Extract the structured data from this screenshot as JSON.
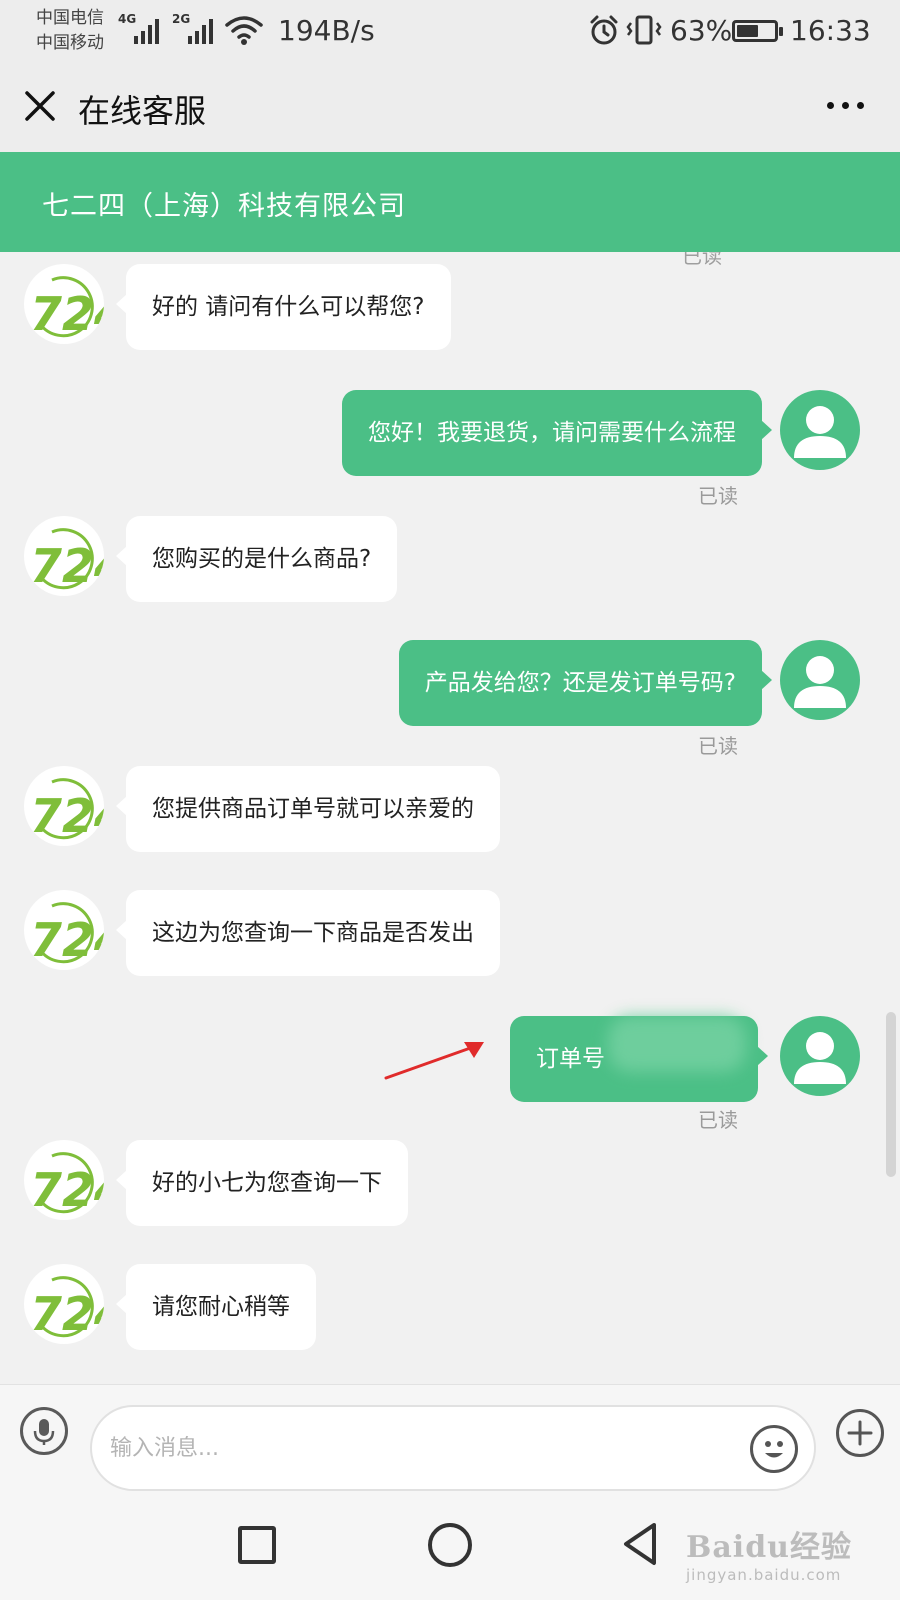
{
  "status_bar": {
    "carrier_1": "中国电信",
    "carrier_2": "中国移动",
    "network_1": "4G",
    "network_2": "2G",
    "net_speed": "194B/s",
    "battery_percent": "63%",
    "battery_level": 0.63,
    "time": "16:33",
    "icons": [
      "alarm-icon",
      "vibrate-icon",
      "wifi-icon",
      "signal-icon"
    ]
  },
  "title_bar": {
    "title": "在线客服",
    "close_icon": "close-icon",
    "more_icon": "more-icon"
  },
  "banner": {
    "company_name": "七二四（上海）科技有限公司",
    "color": "#4bbf86"
  },
  "chat": {
    "peek_text": "已读",
    "bot_avatar_text": "724",
    "messages": [
      {
        "side": "in",
        "text": "好的 请问有什么可以帮您?"
      },
      {
        "side": "out",
        "text": "您好！我要退货，请问需要什么流程",
        "status": "已读"
      },
      {
        "side": "in",
        "text": "您购买的是什么商品?"
      },
      {
        "side": "out",
        "text": "产品发给您？还是发订单号码?",
        "status": "已读"
      },
      {
        "side": "in",
        "text": "您提供商品订单号就可以亲爱的"
      },
      {
        "side": "in",
        "text": "这边为您查询一下商品是否发出"
      },
      {
        "side": "out",
        "text": "订单号",
        "status": "已读"
      },
      {
        "side": "in",
        "text": "好的小七为您查询一下"
      },
      {
        "side": "in",
        "text": "请您耐心稍等"
      }
    ]
  },
  "input_bar": {
    "placeholder": "输入消息...",
    "value": "",
    "icons": [
      "microphone-icon",
      "emoji-icon",
      "plus-icon"
    ]
  },
  "nav_bar": {
    "icons": [
      "recent-apps-icon",
      "home-icon",
      "back-icon"
    ]
  },
  "watermark": {
    "logo": "Baidu经验",
    "url": "jingyan.baidu.com"
  },
  "colors": {
    "accent": "#4bbf86",
    "background": "#f1f1f1",
    "annotation_arrow": "#e02b2b"
  }
}
